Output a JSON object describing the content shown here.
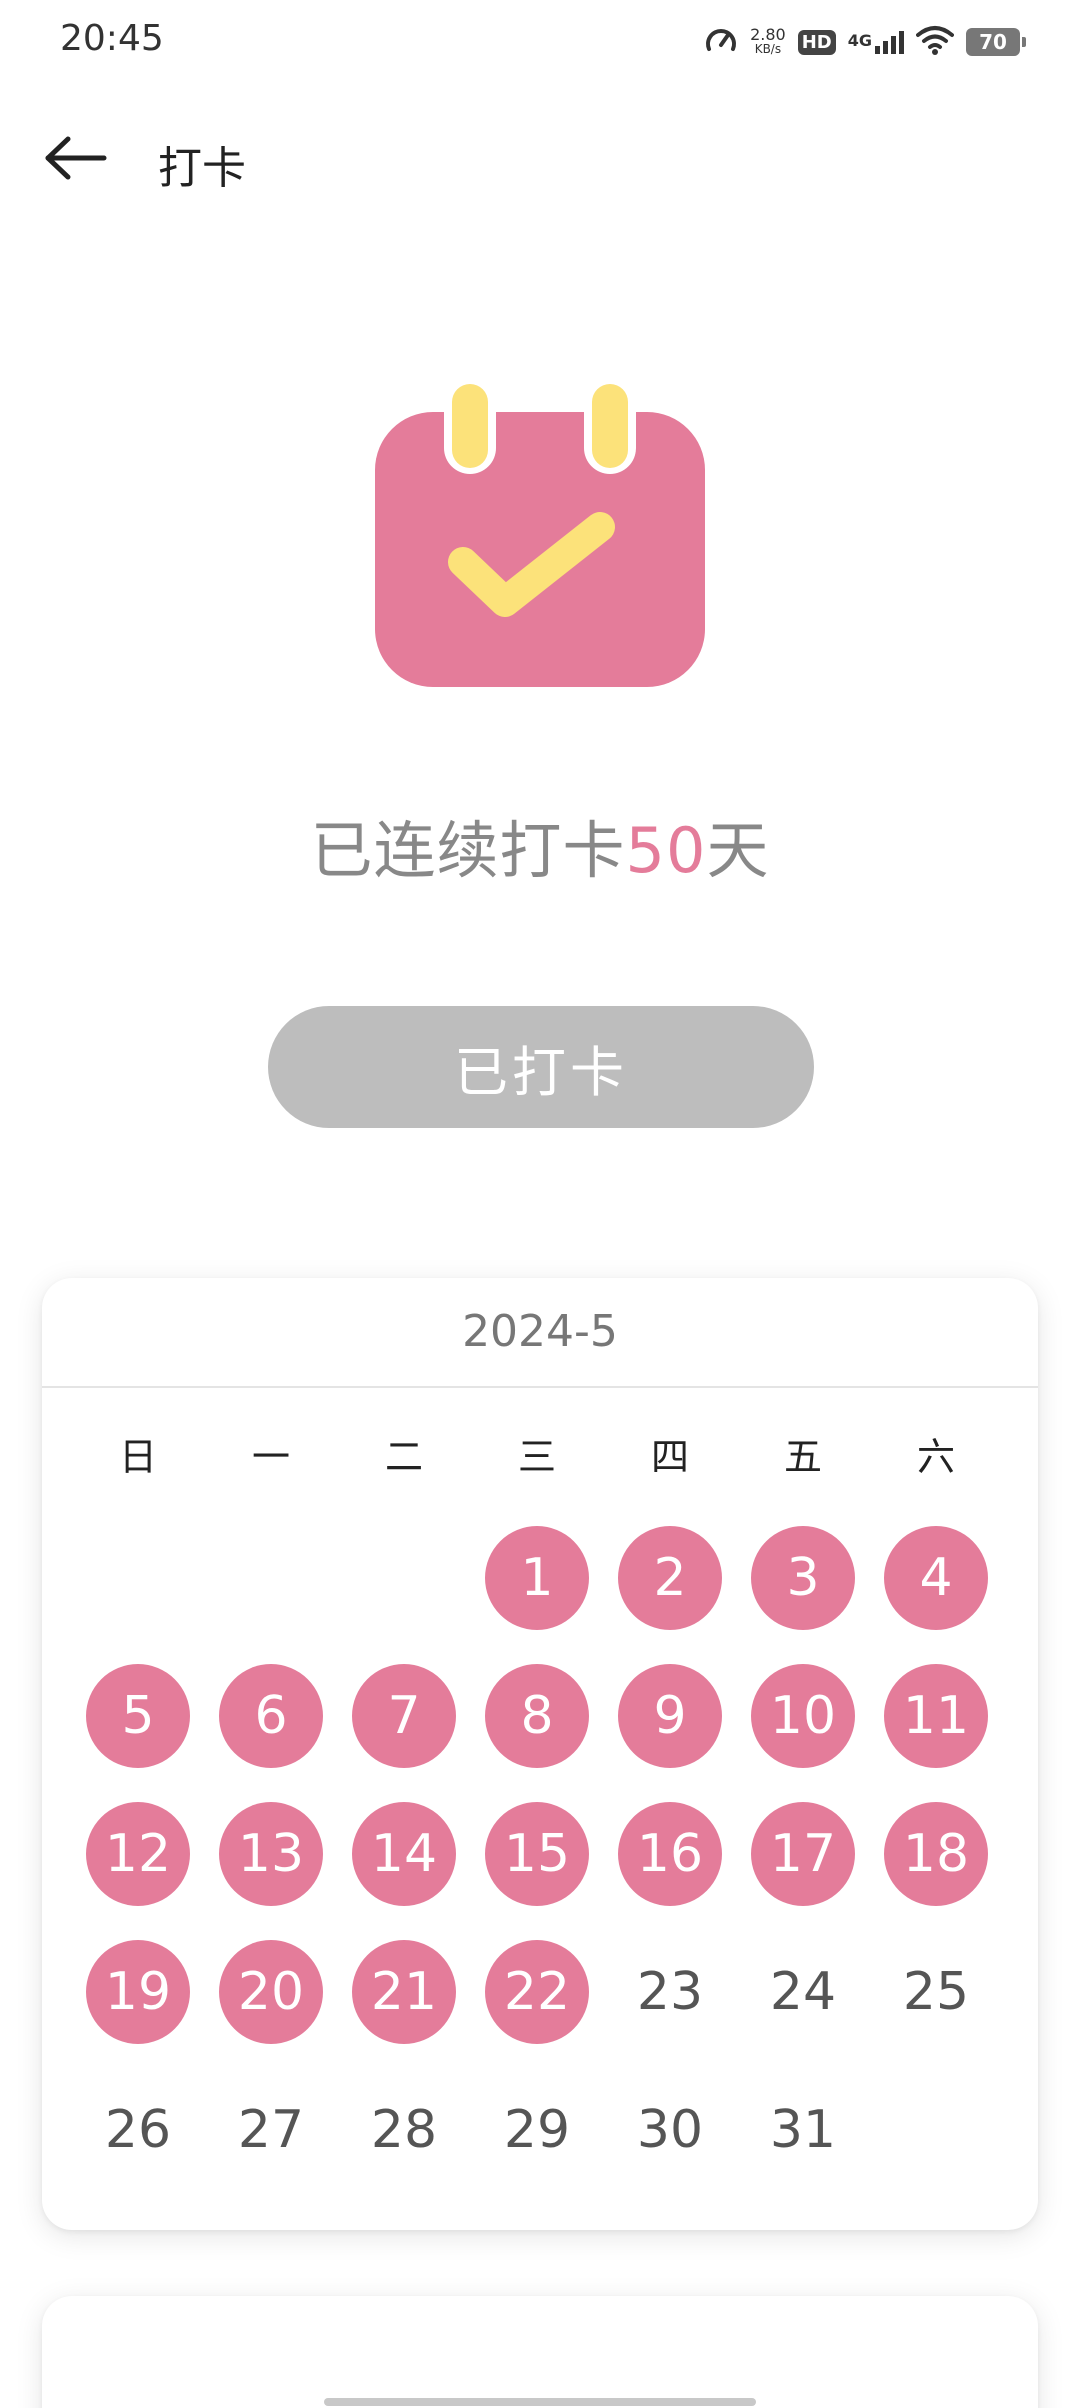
{
  "status_bar": {
    "time": "20:45",
    "net_speed_value": "2.80",
    "net_speed_unit": "KB/s",
    "hd": "HD",
    "network": "4G",
    "battery": "70"
  },
  "header": {
    "title": "打卡"
  },
  "streak": {
    "prefix": "已连续打卡",
    "count": "50",
    "suffix": "天"
  },
  "checkin_button": {
    "label": "已打卡"
  },
  "calendar": {
    "month": "2024-5",
    "weekdays": [
      "日",
      "一",
      "二",
      "三",
      "四",
      "五",
      "六"
    ],
    "first_weekday_index": 3,
    "days_in_month": 31,
    "checked_days": [
      1,
      2,
      3,
      4,
      5,
      6,
      7,
      8,
      9,
      10,
      11,
      12,
      13,
      14,
      15,
      16,
      17,
      18,
      19,
      20,
      21,
      22
    ]
  },
  "colors": {
    "accent": "#e47c9a",
    "icon_yellow": "#fce27a",
    "button_disabled": "#bdbdbd"
  }
}
